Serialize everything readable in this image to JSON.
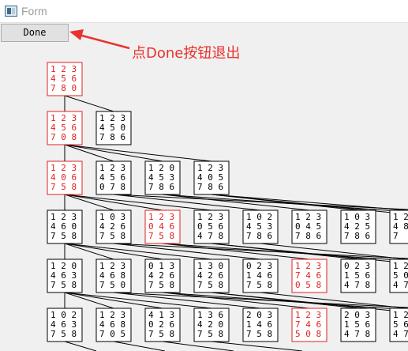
{
  "window": {
    "title": "Form"
  },
  "toolbar": {
    "done_label": "Done"
  },
  "annotation": {
    "text": "点Done按钮退出",
    "color": "#e8322e"
  },
  "colors": {
    "solution_path": "#e02020",
    "normal": "#000000"
  },
  "tree": {
    "levels": [
      [
        {
          "grid": [
            "1 2 3",
            "4 5 6",
            "7 8 0"
          ],
          "highlight": true
        }
      ],
      [
        {
          "grid": [
            "1 2 3",
            "4 5 6",
            "7 0 8"
          ],
          "highlight": true
        },
        {
          "grid": [
            "1 2 3",
            "4 5 0",
            "7 8 6"
          ],
          "highlight": false
        }
      ],
      [
        {
          "grid": [
            "1 2 3",
            "4 0 6",
            "7 5 8"
          ],
          "highlight": true
        },
        {
          "grid": [
            "1 2 3",
            "4 5 6",
            "0 7 8"
          ],
          "highlight": false
        },
        {
          "grid": [
            "1 2 0",
            "4 5 3",
            "7 8 6"
          ],
          "highlight": false
        },
        {
          "grid": [
            "1 2 3",
            "4 0 5",
            "7 8 6"
          ],
          "highlight": false
        }
      ],
      [
        {
          "grid": [
            "1 2 3",
            "4 6 0",
            "7 5 8"
          ],
          "highlight": false
        },
        {
          "grid": [
            "1 0 3",
            "4 2 6",
            "7 5 8"
          ],
          "highlight": false
        },
        {
          "grid": [
            "1 2 3",
            "0 4 6",
            "7 5 8"
          ],
          "highlight": true
        },
        {
          "grid": [
            "1 2 3",
            "0 5 6",
            "4 7 8"
          ],
          "highlight": false
        },
        {
          "grid": [
            "1 0 2",
            "4 5 3",
            "7 8 6"
          ],
          "highlight": false
        },
        {
          "grid": [
            "1 2 3",
            "0 4 5",
            "7 8 6"
          ],
          "highlight": false
        },
        {
          "grid": [
            "1 0 3",
            "4 2 5",
            "7 8 6"
          ],
          "highlight": false
        },
        {
          "grid": [
            "1 2",
            "4 8",
            "7"
          ],
          "highlight": false
        }
      ],
      [
        {
          "grid": [
            "1 2 0",
            "4 6 3",
            "7 5 8"
          ],
          "highlight": false
        },
        {
          "grid": [
            "1 2 3",
            "4 6 8",
            "7 5 0"
          ],
          "highlight": false
        },
        {
          "grid": [
            "0 1 3",
            "4 2 6",
            "7 5 8"
          ],
          "highlight": false
        },
        {
          "grid": [
            "1 3 0",
            "4 2 6",
            "7 5 8"
          ],
          "highlight": false
        },
        {
          "grid": [
            "0 2 3",
            "1 4 6",
            "7 5 8"
          ],
          "highlight": false
        },
        {
          "grid": [
            "1 2 3",
            "7 4 6",
            "0 5 8"
          ],
          "highlight": true
        },
        {
          "grid": [
            "0 2 3",
            "1 5 6",
            "4 7 8"
          ],
          "highlight": false
        },
        {
          "grid": [
            "1 2",
            "5 0",
            "4 7"
          ],
          "highlight": false
        }
      ],
      [
        {
          "grid": [
            "1 0 2",
            "4 6 3",
            "7 5 8"
          ],
          "highlight": false
        },
        {
          "grid": [
            "1 2 3",
            "4 6 8",
            "7 0 5"
          ],
          "highlight": false
        },
        {
          "grid": [
            "4 1 3",
            "0 2 6",
            "7 5 8"
          ],
          "highlight": false
        },
        {
          "grid": [
            "1 3 6",
            "4 2 0",
            "7 5 8"
          ],
          "highlight": false
        },
        {
          "grid": [
            "2 0 3",
            "1 4 6",
            "7 5 8"
          ],
          "highlight": false
        },
        {
          "grid": [
            "1 2 3",
            "7 4 6",
            "5 0 8"
          ],
          "highlight": true
        },
        {
          "grid": [
            "2 0 3",
            "1 5 6",
            "4 7 8"
          ],
          "highlight": false
        },
        {
          "grid": [
            "1 2",
            "5 6",
            "4 7"
          ],
          "highlight": false
        }
      ]
    ]
  }
}
